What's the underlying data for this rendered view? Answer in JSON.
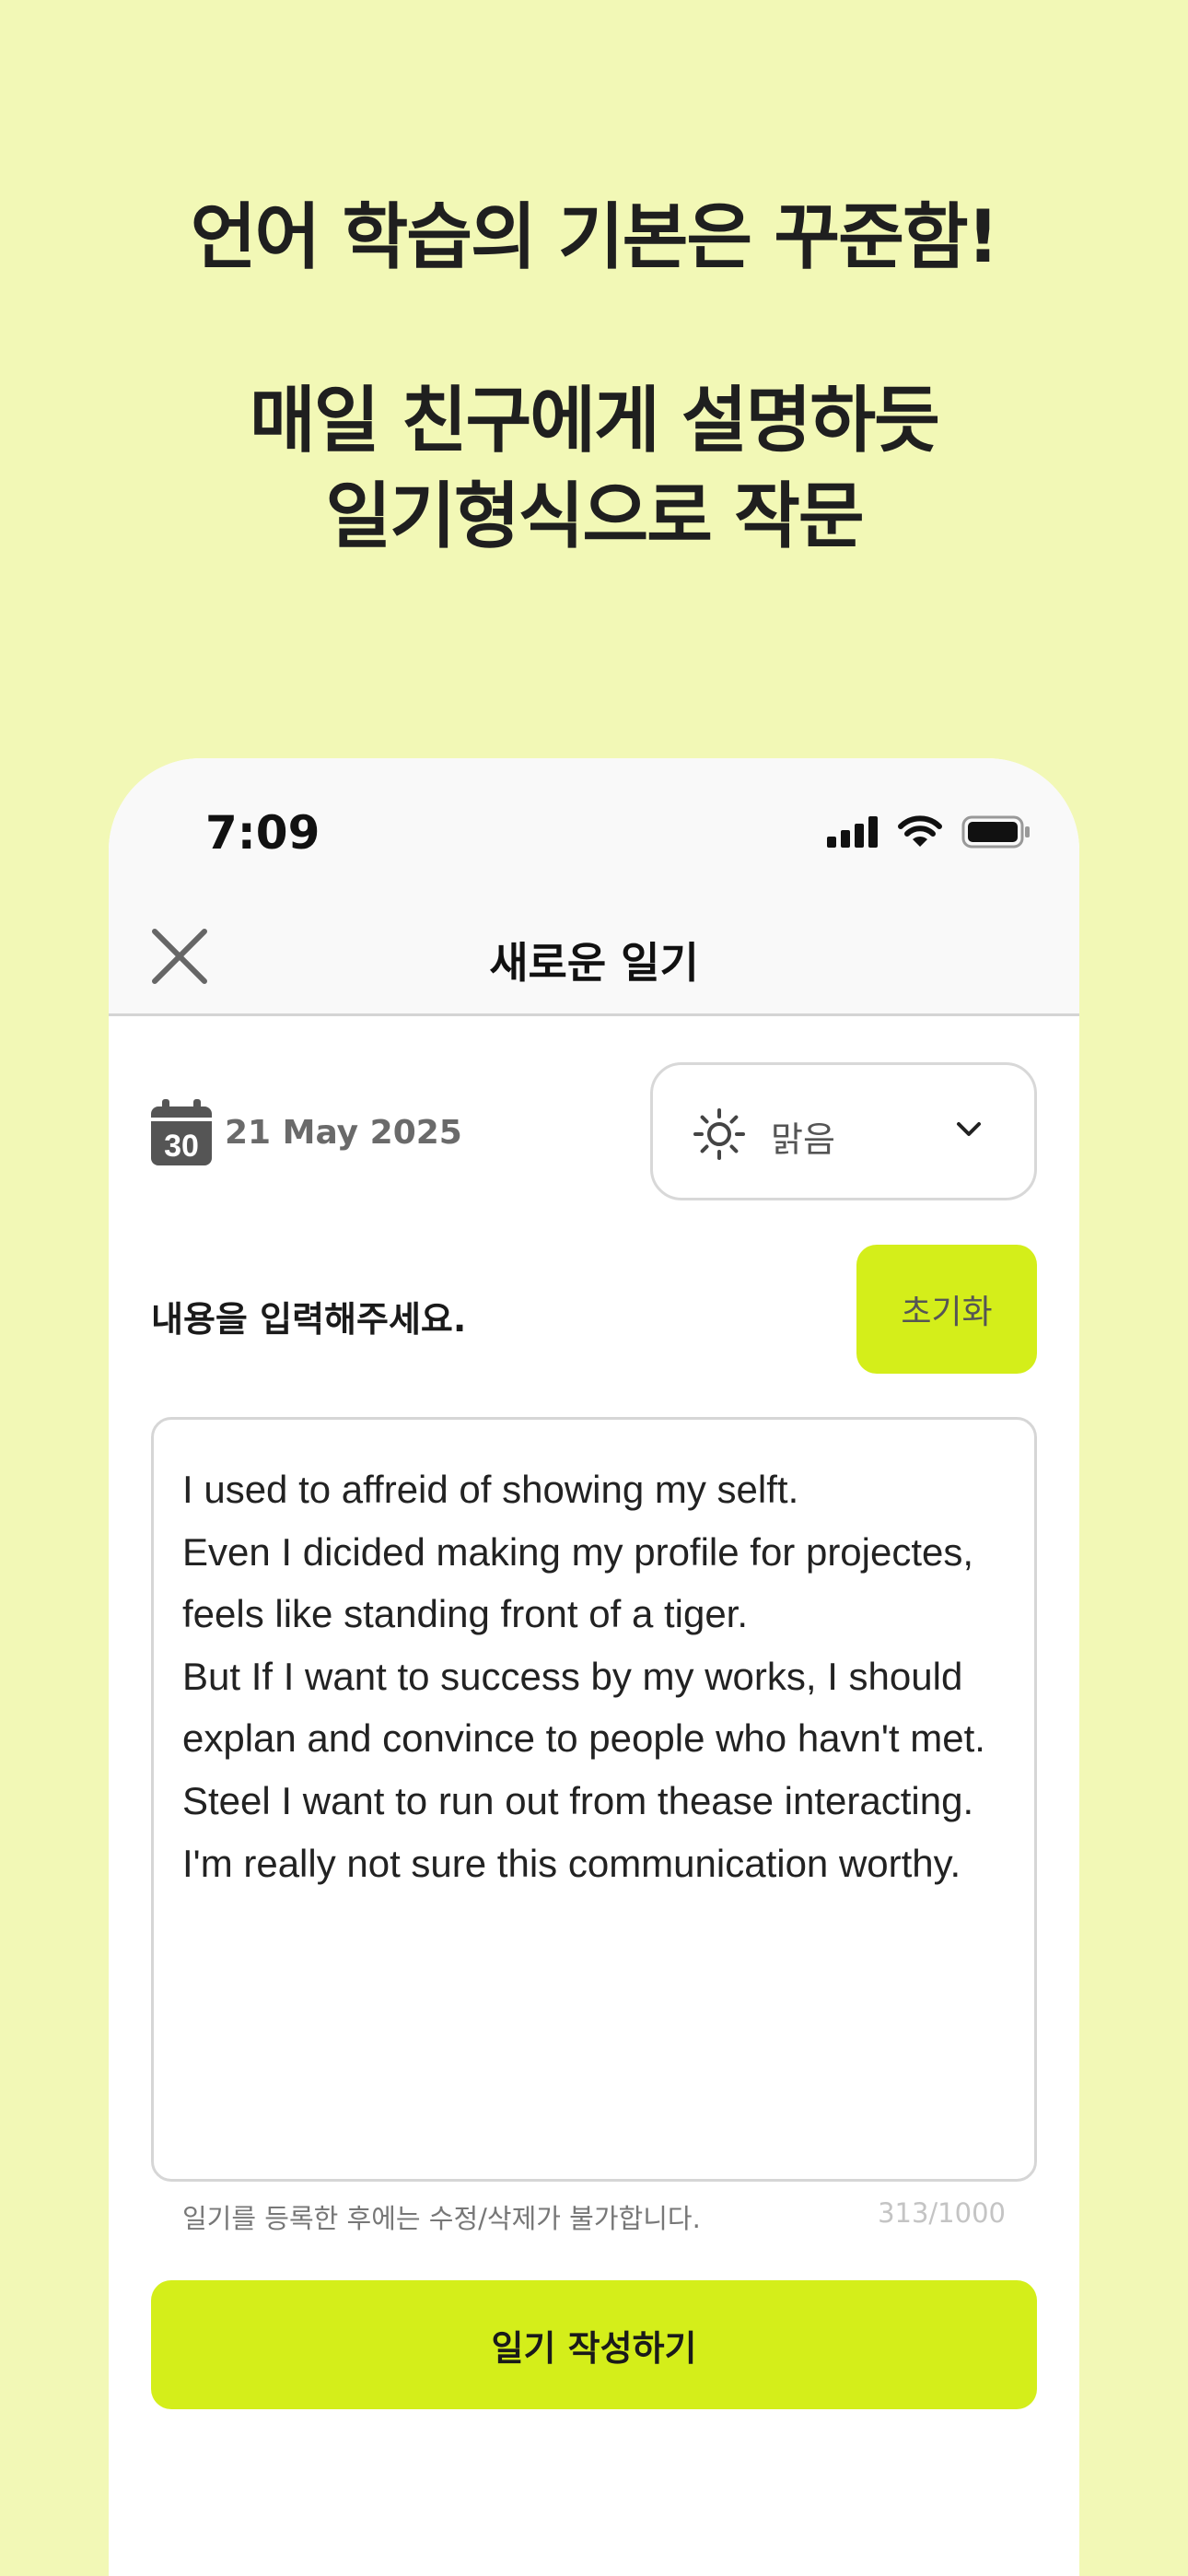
{
  "promo": {
    "line1": "언어 학습의 기본은 꾸준함!",
    "line2": "매일 친구에게 설명하듯",
    "line3": "일기형식으로 작문"
  },
  "status_bar": {
    "time": "7:09",
    "icons": [
      "signal-icon",
      "wifi-icon",
      "battery-icon"
    ]
  },
  "nav": {
    "close_icon": "close-icon",
    "title": "새로운 일기"
  },
  "entry": {
    "calendar_day": "30",
    "date": "21 May 2025",
    "weather": {
      "selected": "맑음",
      "icon": "sun-icon"
    },
    "prompt": "내용을 입력해주세요.",
    "reset_label": "초기화",
    "text": "I used to affreid of showing my selft.\nEven I dicided making my profile for projectes, feels like standing front of a tiger.\nBut If I want to success by my works, I should explan and convince to people who havn't met.\nSteel I want to run out from thease interacting.\nI'm really not sure this communication worthy.",
    "notice": "일기를 등록한 후에는 수정/삭제가 불가합니다.",
    "counter": "313/1000",
    "submit_label": "일기 작성하기"
  },
  "colors": {
    "background": "#f2f8b6",
    "accent": "#d4ee1a"
  }
}
